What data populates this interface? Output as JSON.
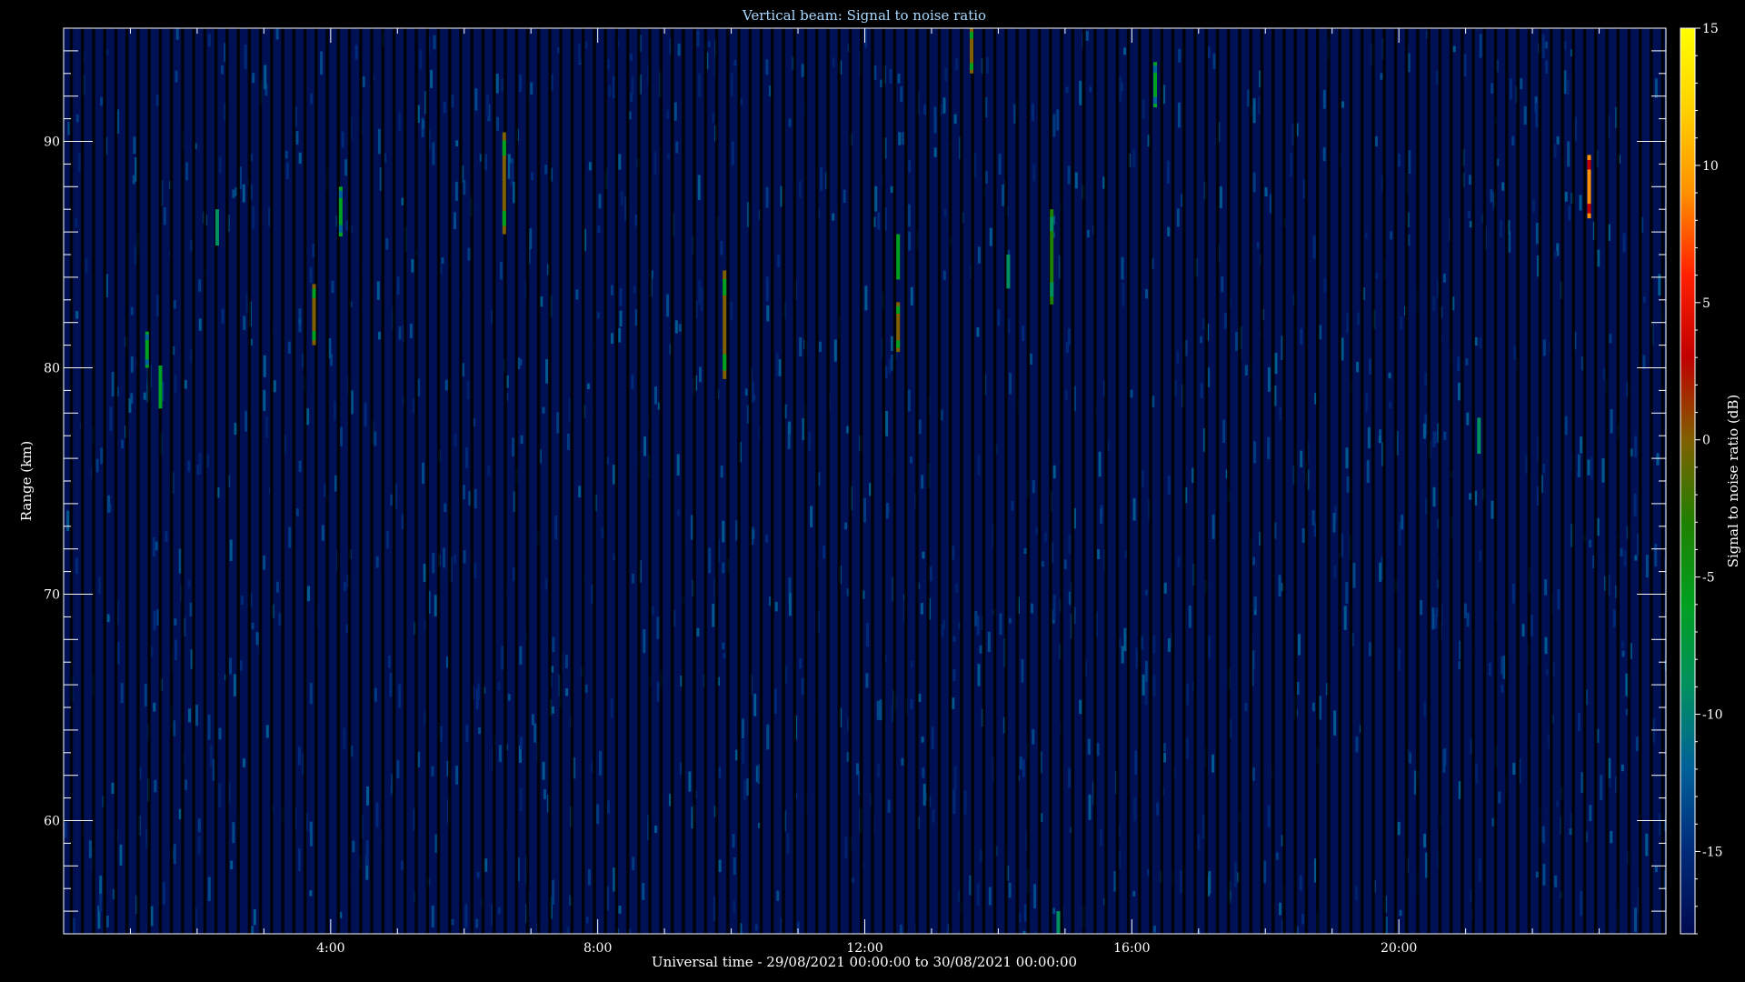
{
  "chart_data": {
    "type": "heatmap",
    "title": "Vertical beam: Signal to noise ratio",
    "xlabel": "Universal time - 29/08/2021 00:00:00 to 30/08/2021 00:00:00",
    "ylabel": "Range (km)",
    "colorbar_label": "Signal to noise ratio (dB)",
    "x_unit": "hours UT",
    "xlim": [
      0,
      24
    ],
    "ylim": [
      55,
      95
    ],
    "x_ticks": [
      {
        "value": 4,
        "label": "4:00"
      },
      {
        "value": 8,
        "label": "8:00"
      },
      {
        "value": 12,
        "label": "12:00"
      },
      {
        "value": 16,
        "label": "16:00"
      },
      {
        "value": 20,
        "label": "20:00"
      }
    ],
    "y_ticks": [
      {
        "value": 60,
        "label": "60"
      },
      {
        "value": 70,
        "label": "70"
      },
      {
        "value": 80,
        "label": "80"
      },
      {
        "value": 90,
        "label": "90"
      }
    ],
    "colorbar_range": [
      -18,
      15
    ],
    "colorbar_ticks": [
      {
        "value": 15,
        "label": "15"
      },
      {
        "value": 10,
        "label": "10"
      },
      {
        "value": 5,
        "label": "5"
      },
      {
        "value": 0,
        "label": "0"
      },
      {
        "value": -5,
        "label": "-5"
      },
      {
        "value": -10,
        "label": "-10"
      },
      {
        "value": -15,
        "label": "-15"
      }
    ],
    "background_snr_db": -16,
    "colormap": [
      "#000a50",
      "#002a78",
      "#00609a",
      "#009060",
      "#00a020",
      "#208000",
      "#806000",
      "#c00000",
      "#ff2000",
      "#ff9000",
      "#ffd000",
      "#ffff00"
    ],
    "echoes": [
      {
        "time": 1.25,
        "range_min": 80.0,
        "range_max": 81.6,
        "snr": -5
      },
      {
        "time": 1.45,
        "range_min": 78.2,
        "range_max": 80.1,
        "snr": -7
      },
      {
        "time": 2.3,
        "range_min": 85.4,
        "range_max": 87.0,
        "snr": -8
      },
      {
        "time": 3.75,
        "range_min": 81.0,
        "range_max": 83.7,
        "snr": 1
      },
      {
        "time": 4.15,
        "range_min": 85.8,
        "range_max": 88.0,
        "snr": -5
      },
      {
        "time": 6.6,
        "range_min": 85.9,
        "range_max": 90.4,
        "snr": 1
      },
      {
        "time": 9.9,
        "range_min": 79.5,
        "range_max": 84.3,
        "snr": 1
      },
      {
        "time": 12.5,
        "range_min": 83.9,
        "range_max": 85.9,
        "snr": -6
      },
      {
        "time": 12.5,
        "range_min": 80.7,
        "range_max": 82.9,
        "snr": 0
      },
      {
        "time": 13.6,
        "range_min": 93.0,
        "range_max": 95.0,
        "snr": -1
      },
      {
        "time": 14.15,
        "range_min": 83.5,
        "range_max": 85.0,
        "snr": -9
      },
      {
        "time": 14.8,
        "range_min": 82.8,
        "range_max": 87.0,
        "snr": -4
      },
      {
        "time": 14.9,
        "range_min": 55.0,
        "range_max": 56.0,
        "snr": -8
      },
      {
        "time": 16.35,
        "range_min": 91.5,
        "range_max": 93.5,
        "snr": -5
      },
      {
        "time": 21.2,
        "range_min": 76.2,
        "range_max": 77.8,
        "snr": -8
      },
      {
        "time": 22.85,
        "range_min": 86.6,
        "range_max": 89.4,
        "snr": 9
      }
    ]
  }
}
